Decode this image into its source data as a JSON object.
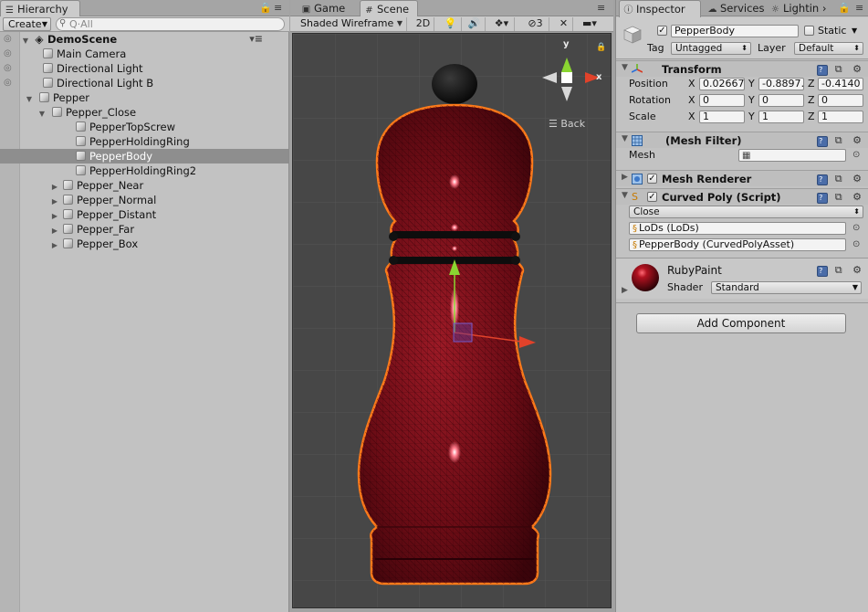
{
  "hierarchy": {
    "tab_label": "Hierarchy",
    "create_label": "Create",
    "search_placeholder": "Q·All",
    "scene_name": "DemoScene",
    "items": [
      {
        "label": "Main Camera",
        "depth": 1,
        "foldout": ""
      },
      {
        "label": "Directional Light",
        "depth": 1,
        "foldout": ""
      },
      {
        "label": "Directional Light B",
        "depth": 1,
        "foldout": ""
      },
      {
        "label": "Pepper",
        "depth": 0,
        "foldout": "▼"
      },
      {
        "label": "Pepper_Close",
        "depth": 1,
        "foldout": "▼"
      },
      {
        "label": "PepperTopScrew",
        "depth": 2,
        "foldout": ""
      },
      {
        "label": "PepperHoldingRing",
        "depth": 2,
        "foldout": ""
      },
      {
        "label": "PepperBody",
        "depth": 2,
        "foldout": "",
        "selected": true
      },
      {
        "label": "PepperHoldingRing2",
        "depth": 2,
        "foldout": ""
      },
      {
        "label": "Pepper_Near",
        "depth": 1,
        "foldout": "▶"
      },
      {
        "label": "Pepper_Normal",
        "depth": 1,
        "foldout": "▶"
      },
      {
        "label": "Pepper_Distant",
        "depth": 1,
        "foldout": "▶"
      },
      {
        "label": "Pepper_Far",
        "depth": 1,
        "foldout": "▶"
      },
      {
        "label": "Pepper_Box",
        "depth": 1,
        "foldout": "▶"
      }
    ]
  },
  "scene": {
    "tab_game": "Game",
    "tab_scene": "Scene",
    "shading_mode": "Shaded Wireframe",
    "btn_2d": "2D",
    "gizmo_count": "3",
    "gizmo_back_label": "Back",
    "axis_y": "y",
    "axis_x": "x",
    "colors": {
      "background": "#474747",
      "grid": "#5a5a5a",
      "body": "#7a0f18",
      "outline": "#ff7a1a",
      "axis_x": "#e1422a",
      "axis_y": "#8ad531"
    }
  },
  "inspector": {
    "tab_inspector": "Inspector",
    "tab_services": "Services",
    "tab_lighting": "Lightin",
    "object_name": "PepperBody",
    "static_label": "Static",
    "tag_label": "Tag",
    "tag_value": "Untagged",
    "layer_label": "Layer",
    "layer_value": "Default",
    "transform": {
      "title": "Transform",
      "position_label": "Position",
      "rotation_label": "Rotation",
      "scale_label": "Scale",
      "position": {
        "x": "0.02667",
        "y": "-0.8897…",
        "z": "-0.4140"
      },
      "rotation": {
        "x": "0",
        "y": "0",
        "z": "0"
      },
      "scale": {
        "x": "1",
        "y": "1",
        "z": "1"
      }
    },
    "mesh_filter": {
      "title": "(Mesh Filter)",
      "mesh_label": "Mesh",
      "mesh_value": ""
    },
    "mesh_renderer": {
      "title": "Mesh Renderer"
    },
    "curved_poly": {
      "title": "Curved Poly (Script)",
      "lod_value": "Close",
      "field1": "LoDs (LoDs)",
      "field2": "PepperBody (CurvedPolyAsset)"
    },
    "material": {
      "name": "RubyPaint",
      "shader_label": "Shader",
      "shader_value": "Standard",
      "color": "#8b0a14"
    },
    "add_component_label": "Add Component"
  }
}
